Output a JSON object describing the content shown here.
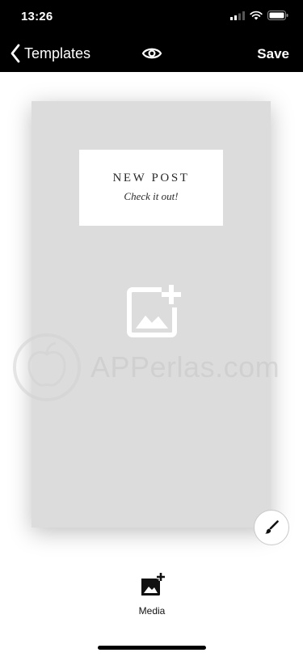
{
  "status_bar": {
    "time": "13:26",
    "icons": [
      "cellular-signal-icon",
      "wifi-icon",
      "battery-icon"
    ]
  },
  "nav": {
    "back_label": "Templates",
    "preview_icon": "eye-icon",
    "save_label": "Save"
  },
  "canvas": {
    "background": "#dcdcdc",
    "text_card": {
      "title": "NEW POST",
      "subtitle": "Check it out!"
    },
    "add_media_icon": "add-image-icon"
  },
  "watermark": {
    "text": "APPerlas.com"
  },
  "tools": {
    "brush_icon": "paintbrush-icon"
  },
  "bottom_toolbar": {
    "media_label": "Media",
    "media_icon": "add-image-icon"
  }
}
